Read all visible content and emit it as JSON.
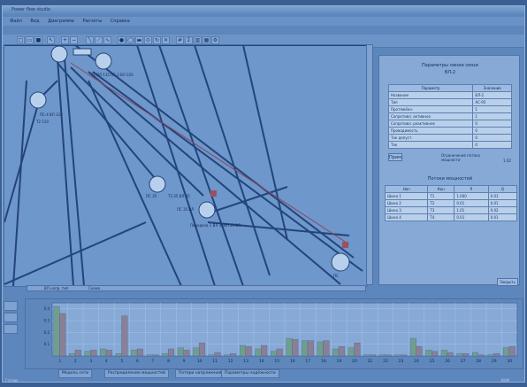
{
  "window": {
    "title": "Power flow studio"
  },
  "menu": {
    "items": [
      "Файл",
      "Вид",
      "Диаграмма",
      "Расчеты",
      "Справка"
    ]
  },
  "canvas": {
    "node_labels": [
      "Т1 ВЛ 115",
      "ПС-3 ВЛ 220",
      "ПС-4 ВЛ 110",
      "Т2 110",
      "ПС 35",
      "Т3 35 ВЛ 35",
      "ПС 35 ВЛ",
      "Передача 1 ВЛ 35",
      "ВЛ 35 ВЛ",
      "ПС"
    ],
    "bottom_tab": "ВЛ напр. тип",
    "bottom_tab2": "Схема"
  },
  "panel": {
    "title_line1": "Параметры линии связи",
    "title_line2": "ВЛ-2",
    "prop_headers": [
      "Параметр",
      "Значение"
    ],
    "props": [
      [
        "Название",
        "ВЛ-2"
      ],
      [
        "Тип",
        "АС-95"
      ],
      [
        "Протяжённ.",
        "1"
      ],
      [
        "Сопротивл. активное",
        "1"
      ],
      [
        "Сопротивл. реактивное",
        "0"
      ],
      [
        "Проводимость",
        "0"
      ],
      [
        "Ток допуст.",
        "0"
      ],
      [
        "Ток",
        "0"
      ]
    ],
    "apply_button": "Прим.",
    "apply_note": "Ограничение потока мощности",
    "apply_value": "1.02",
    "flows_title": "Потоки мощностей",
    "flow_headers": [
      "Нач",
      "Кон",
      "P",
      "Q"
    ],
    "flows": [
      [
        "Шина 1",
        "Т1",
        "1.000",
        "0.01"
      ],
      [
        "Шина 2",
        "Т2",
        "0.01",
        "0.01"
      ],
      [
        "Шина 3",
        "Т3",
        "1.01",
        "0.02"
      ],
      [
        "Шина 4",
        "Т4",
        "0.01",
        "0.01"
      ]
    ],
    "close_button": "Закрыть"
  },
  "chart_data": {
    "type": "bar",
    "categories": [
      "1",
      "2",
      "3",
      "4",
      "5",
      "6",
      "7",
      "8",
      "9",
      "10",
      "11",
      "12",
      "13",
      "14",
      "15",
      "16",
      "17",
      "18",
      "19",
      "20",
      "21",
      "22",
      "23",
      "24",
      "25",
      "26",
      "27",
      "28",
      "29",
      "30"
    ],
    "yticks": [
      "0.4",
      "0.3",
      "0.2",
      "0.1"
    ],
    "ylim": [
      0,
      0.45
    ],
    "series": [
      {
        "color": "#6f9e8f",
        "values": [
          0.42,
          0.02,
          0.04,
          0.06,
          0.02,
          0.05,
          0.01,
          0.02,
          0.07,
          0.07,
          0.01,
          0.01,
          0.09,
          0.06,
          0.04,
          0.15,
          0.13,
          0.12,
          0.06,
          0.07,
          0.01,
          0.01,
          0.01,
          0.15,
          0.05,
          0.05,
          0.02,
          0.03,
          0.01,
          0.07
        ]
      },
      {
        "color": "#8a7f97",
        "values": [
          0.36,
          0.05,
          0.05,
          0.05,
          0.34,
          0.06,
          0.01,
          0.06,
          0.05,
          0.11,
          0.03,
          0.02,
          0.08,
          0.09,
          0.06,
          0.14,
          0.13,
          0.13,
          0.08,
          0.11,
          0.01,
          0.01,
          0.01,
          0.08,
          0.04,
          0.03,
          0.02,
          0.01,
          0.02,
          0.08
        ]
      }
    ]
  },
  "tabs": [
    "Модель сети",
    "Распределение мощностей",
    "Потери напряжения",
    "Параметры надёжности"
  ],
  "status": {
    "left": "Готово",
    "right": "NUM"
  }
}
